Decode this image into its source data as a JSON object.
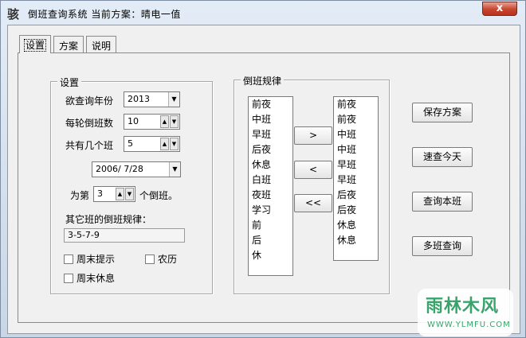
{
  "window": {
    "app_icon_glyph": "骇",
    "title": "倒班查询系统   当前方案：晴电一值",
    "close_label": "x"
  },
  "tabs": [
    {
      "label": "设置",
      "active": true
    },
    {
      "label": "方案",
      "active": false
    },
    {
      "label": "说明",
      "active": false
    }
  ],
  "settings": {
    "group_title": "设置",
    "year_label": "欲查询年份",
    "year_value": "2013",
    "cycle_label": "每轮倒班数",
    "cycle_value": "10",
    "shifts_label": "共有几个班",
    "shifts_value": "5",
    "date_value": "2006/ 7/28",
    "rank_prefix": "为第",
    "rank_value": "3",
    "rank_suffix": "个倒班。",
    "other_rule_label": "其它班的倒班规律：",
    "other_rule_value": "3-5-7-9",
    "weekend_reminder_label": "周末提示",
    "lunar_label": "农历",
    "weekend_rest_label": "周末休息"
  },
  "rule": {
    "group_title": "倒班规律",
    "source_items": [
      "前夜",
      "中班",
      "早班",
      "后夜",
      "休息",
      "白班",
      "夜班",
      "学习",
      "前",
      "后",
      "休"
    ],
    "target_items": [
      "前夜",
      "前夜",
      "中班",
      "中班",
      "早班",
      "早班",
      "后夜",
      "后夜",
      "休息",
      "休息"
    ],
    "add_button": ">",
    "remove_button": "<",
    "clear_button": "<<"
  },
  "actions": {
    "save": "保存方案",
    "today": "速查今天",
    "this_shift": "查询本班",
    "multi_shift": "多班查询"
  },
  "watermark": {
    "text": "雨林木风",
    "url": "WWW.YLMFU.COM"
  }
}
